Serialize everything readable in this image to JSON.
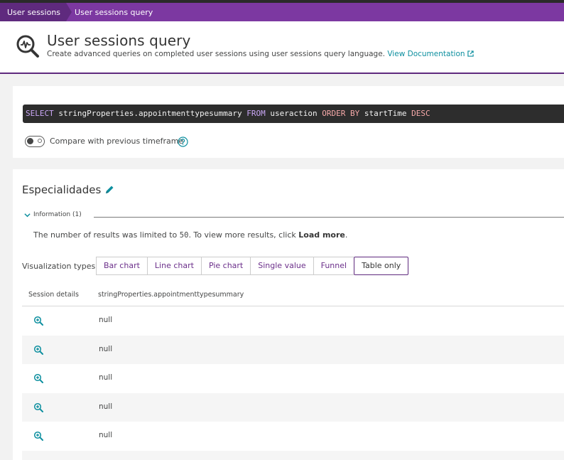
{
  "breadcrumb": {
    "items": [
      "User sessions",
      "User sessions query"
    ]
  },
  "header": {
    "title": "User sessions query",
    "subtitle": "Create advanced queries on completed user sessions using user sessions query language.",
    "doc_link": "View Documentation"
  },
  "query": {
    "tokens": {
      "select": "SELECT",
      "field": "stringProperties.appointmenttypesummary",
      "from": "FROM",
      "table": "useraction",
      "order_by": "ORDER BY",
      "order_field": "startTime",
      "dir": "DESC"
    }
  },
  "compare": {
    "label": "Compare with previous timeframe",
    "enabled": false
  },
  "result": {
    "title": "Especialidades",
    "info_label": "Information",
    "info_count": "(1)",
    "info_text_before": "The number of results was limited to ",
    "info_limit": "50",
    "info_text_mid": ". To view more results, click ",
    "info_link": "Load more",
    "info_text_after": "."
  },
  "visualization": {
    "label": "Visualization types:",
    "types": [
      "Bar chart",
      "Line chart",
      "Pie chart",
      "Single value",
      "Funnel",
      "Table only"
    ],
    "selected": "Table only"
  },
  "table": {
    "columns": [
      "Session details",
      "stringProperties.appointmenttypesummary"
    ],
    "rows": [
      {
        "value": "null"
      },
      {
        "value": "null"
      },
      {
        "value": "null"
      },
      {
        "value": "null"
      },
      {
        "value": "null"
      }
    ]
  },
  "colors": {
    "brand_purple": "#7c38a1",
    "brand_purple_dark": "#5f2a7e",
    "teal_link": "#0d8f9f",
    "query_bg": "#2d2d2d"
  },
  "icons": [
    "search-analytics-icon",
    "external-link-icon",
    "help-icon",
    "edit-pencil-icon",
    "chevron-down-icon",
    "zoom-in-icon"
  ]
}
